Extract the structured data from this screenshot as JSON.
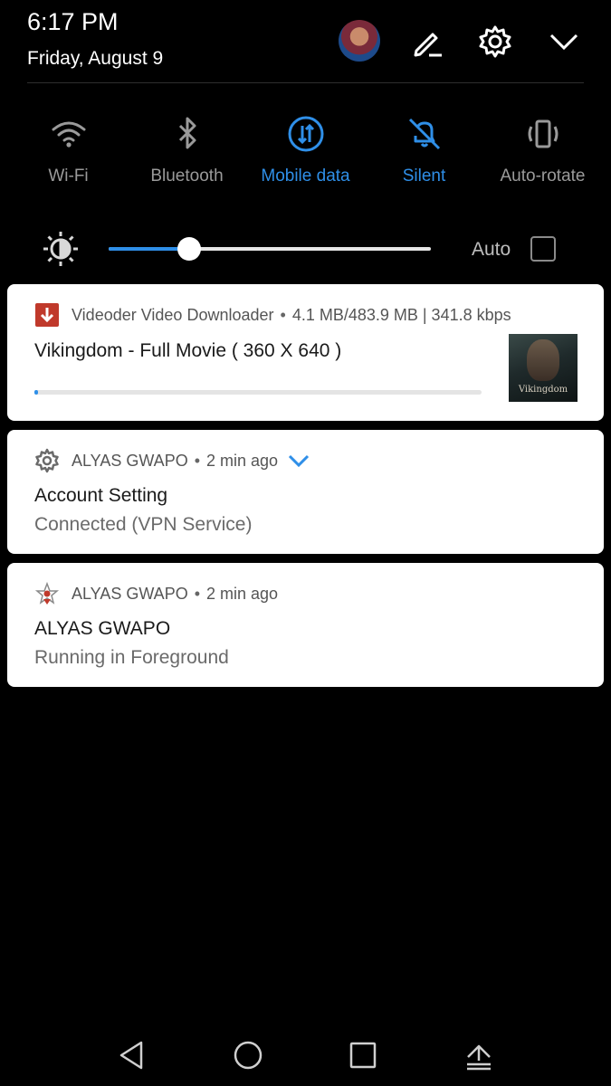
{
  "status": {
    "time": "6:17 PM",
    "date": "Friday, August 9"
  },
  "header_icons": {
    "avatar": "user-avatar",
    "edit": "pencil-icon",
    "settings": "gear-icon",
    "collapse": "chevron-down-icon"
  },
  "quick_settings": [
    {
      "label": "Wi-Fi",
      "icon": "wifi-icon",
      "active": false
    },
    {
      "label": "Bluetooth",
      "icon": "bluetooth-icon",
      "active": false
    },
    {
      "label": "Mobile data",
      "icon": "mobile-data-icon",
      "active": true
    },
    {
      "label": "Silent",
      "icon": "silent-icon",
      "active": true
    },
    {
      "label": "Auto-rotate",
      "icon": "auto-rotate-icon",
      "active": false
    }
  ],
  "brightness": {
    "icon": "brightness-icon",
    "level": 0.25,
    "auto_label": "Auto",
    "auto_checked": false
  },
  "notifications": [
    {
      "app_icon": "download-icon",
      "app_name": "Videoder Video Downloader",
      "meta": "4.1 MB/483.9 MB | 341.8 kbps",
      "title": "Vikingdom - Full Movie ( 360 X 640 )",
      "progress": 0.0085,
      "thumbnail_caption": "Vikingdom"
    },
    {
      "app_icon": "gear-icon",
      "app_name": "ALYAS GWAPO",
      "meta": "2 min ago",
      "title": "Account Setting",
      "body": "Connected (VPN Service)"
    },
    {
      "app_icon": "app-logo-icon",
      "app_name": "ALYAS GWAPO",
      "meta": "2 min ago",
      "title": "ALYAS GWAPO",
      "body": "Running in Foreground"
    }
  ],
  "navbar": [
    {
      "icon": "back-icon"
    },
    {
      "icon": "home-icon"
    },
    {
      "icon": "recents-icon"
    },
    {
      "icon": "notification-shade-icon"
    }
  ],
  "colors": {
    "background": "#000000",
    "accent": "#2f8fe8",
    "inactive": "#9a9a9a",
    "card": "#ffffff"
  }
}
